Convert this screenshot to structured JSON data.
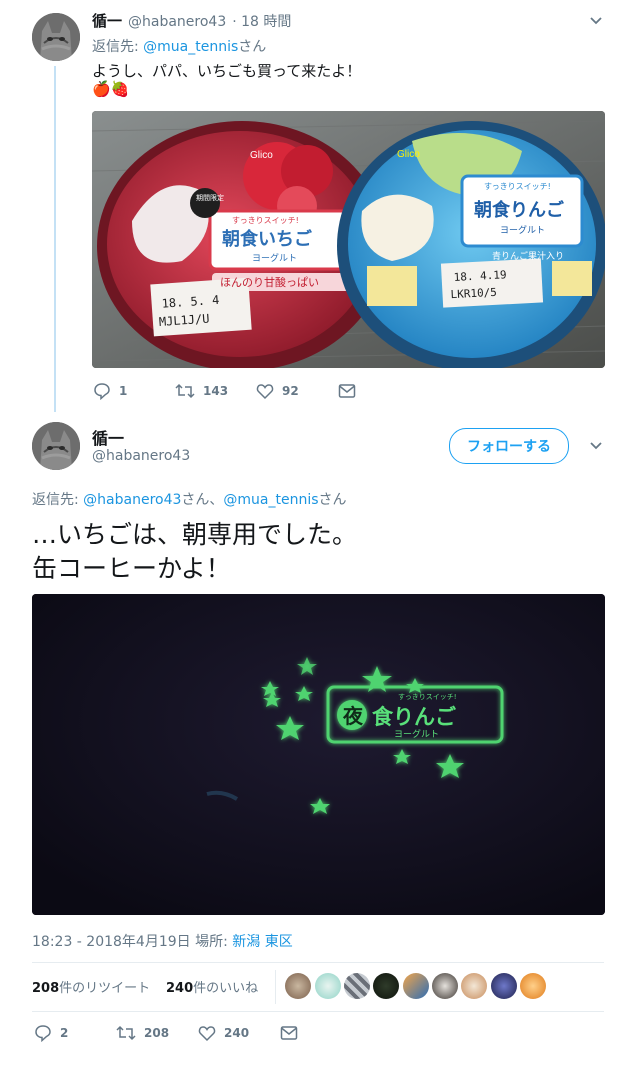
{
  "reply_tweet": {
    "display_name": "循一",
    "handle": "@habanero43",
    "time": "· 18 時間",
    "reply_prefix": "返信先: ",
    "reply_to": "@mua_tennis",
    "reply_suffix": "さん",
    "text": "ようし、パパ、いちごも買って来たよ！",
    "emoji": "🍎🍓",
    "photo_labels": {
      "brand_left": "Glico",
      "product_left": "朝食いちご",
      "sub_left": "ヨーグルト",
      "tag_left": "ほんのり甘酸っぱい",
      "date_left_1": "18. 5. 4",
      "date_left_2": "MJL1J/U",
      "brand_right": "Glico",
      "product_right": "朝食りんご",
      "sub_right": "ヨーグルト",
      "tag_right": "青りんご果汁入り",
      "date_right_1": "18. 4.19",
      "date_right_2": "LKR10/5",
      "switch_left": "すっきりスイッチ!",
      "switch_right": "すっきりスイッチ!",
      "limited": "期間限定"
    },
    "actions": {
      "reply_count": "1",
      "retweet_count": "143",
      "like_count": "92"
    }
  },
  "main_tweet": {
    "display_name": "循一",
    "handle": "@habanero43",
    "follow_label": "フォローする",
    "reply_prefix": "返信先: ",
    "reply_to_1": "@habanero43",
    "reply_mid": "さん、",
    "reply_to_2": "@mua_tennis",
    "reply_suffix": "さん",
    "text_line1": "…いちごは、朝専用でした。",
    "text_line2": "缶コーヒーかよ！",
    "photo_labels": {
      "switch": "すっきりスイッチ!",
      "night": "夜",
      "product": "食りんご",
      "sub": "ヨーグルト"
    },
    "timestamp": "18:23 - 2018年4月19日",
    "location_prefix": "場所: ",
    "location": "新潟 東区",
    "retweets_count": "208",
    "retweets_label": "件のリツイート",
    "likes_count": "240",
    "likes_label": "件のいいね",
    "actions": {
      "reply_count": "2",
      "retweet_count": "208",
      "like_count": "240"
    }
  },
  "colors": {
    "accent": "#1da1f2",
    "link": "#1b95e0",
    "secondary_text": "#657786",
    "thread_line": "#c4e1f5",
    "glow_green": "#59e07a"
  },
  "icons": [
    "chevron-down-icon",
    "reply-icon",
    "retweet-icon",
    "like-icon",
    "message-icon"
  ]
}
